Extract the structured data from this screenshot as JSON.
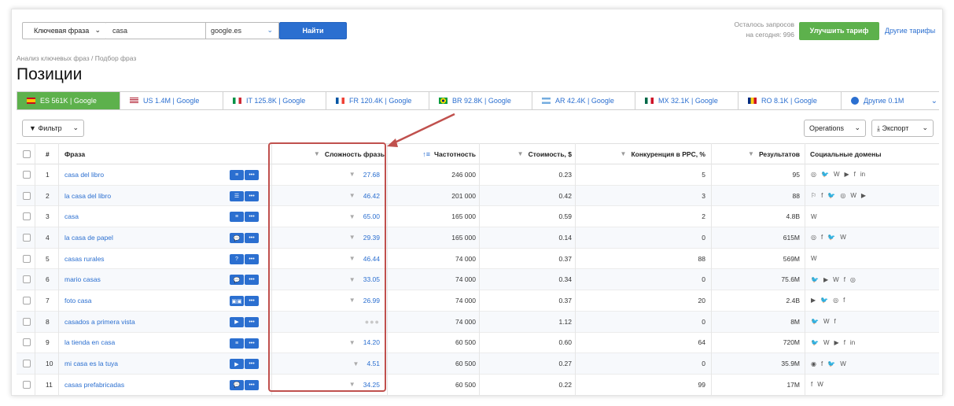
{
  "search": {
    "type_label": "Ключевая фраза",
    "query": "casa",
    "engine": "google.es",
    "find_label": "Найти"
  },
  "quota": {
    "line1": "Осталось запросов",
    "line2": "на сегодня: 996"
  },
  "upgrade_label": "Улучшить тариф",
  "other_plans_label": "Другие тарифы",
  "breadcrumb": "Анализ ключевых фраз / Подбор фраз",
  "page_title": "Позиции",
  "tabs": [
    {
      "label": "ES 561K | Google",
      "flag": "es",
      "active": true
    },
    {
      "label": "US 1.4M | Google",
      "flag": "us"
    },
    {
      "label": "IT 125.8K | Google",
      "flag": "it"
    },
    {
      "label": "FR 120.4K | Google",
      "flag": "fr"
    },
    {
      "label": "BR 92.8K | Google",
      "flag": "br"
    },
    {
      "label": "AR 42.4K | Google",
      "flag": "ar"
    },
    {
      "label": "MX 32.1K | Google",
      "flag": "mx"
    },
    {
      "label": "RO 8.1K | Google",
      "flag": "ro"
    },
    {
      "label": "Другие 0.1M",
      "flag": "globe"
    }
  ],
  "toolbar": {
    "filter_label": "Фильтр",
    "operations_label": "Operations",
    "export_label": "Экспорт"
  },
  "columns": {
    "num": "#",
    "phrase": "Фраза",
    "kd": "Сложность фразы",
    "volume": "Частотность",
    "cpc": "Стоимость, $",
    "competition": "Конкуренция в PPC, %",
    "results": "Результатов",
    "social": "Социальные домены"
  },
  "rows": [
    {
      "n": "1",
      "phrase": "casa del libro",
      "kd": "27.68",
      "volume": "246 000",
      "cpc": "0.23",
      "comp": "5",
      "results": "95",
      "features": [
        "≡",
        "•••"
      ],
      "social": [
        "◎",
        "🐦",
        "W",
        "▶",
        "f",
        "in"
      ]
    },
    {
      "n": "2",
      "phrase": "la casa del libro",
      "kd": "46.42",
      "volume": "201 000",
      "cpc": "0.42",
      "comp": "3",
      "results": "88",
      "features": [
        "☰",
        "•••"
      ],
      "social": [
        "⚐",
        "f",
        "🐦",
        "◎",
        "W",
        "▶"
      ]
    },
    {
      "n": "3",
      "phrase": "casa",
      "kd": "65.00",
      "volume": "165 000",
      "cpc": "0.59",
      "comp": "2",
      "results": "4.8B",
      "features": [
        "≡",
        "•••"
      ],
      "social": [
        "W"
      ]
    },
    {
      "n": "4",
      "phrase": "la casa de papel",
      "kd": "29.39",
      "volume": "165 000",
      "cpc": "0.14",
      "comp": "0",
      "results": "615M",
      "features": [
        "💬",
        "•••"
      ],
      "social": [
        "◎",
        "f",
        "🐦",
        "W"
      ]
    },
    {
      "n": "5",
      "phrase": "casas rurales",
      "kd": "46.44",
      "volume": "74 000",
      "cpc": "0.37",
      "comp": "88",
      "results": "569M",
      "features": [
        "?",
        "•••"
      ],
      "social": [
        "W"
      ]
    },
    {
      "n": "6",
      "phrase": "mario casas",
      "kd": "33.05",
      "volume": "74 000",
      "cpc": "0.34",
      "comp": "0",
      "results": "75.6M",
      "features": [
        "💬",
        "•••"
      ],
      "social": [
        "🐦",
        "▶",
        "W",
        "f",
        "◎"
      ]
    },
    {
      "n": "7",
      "phrase": "foto casa",
      "kd": "26.99",
      "volume": "74 000",
      "cpc": "0.37",
      "comp": "20",
      "results": "2.4B",
      "features": [
        "▣▣",
        "•••"
      ],
      "social": [
        "▶",
        "🐦",
        "◎",
        "f"
      ]
    },
    {
      "n": "8",
      "phrase": "casados a primera vista",
      "kd": "",
      "volume": "74 000",
      "cpc": "1.12",
      "comp": "0",
      "results": "8M",
      "features": [
        "▶",
        "•••"
      ],
      "social": [
        "🐦",
        "W",
        "f"
      ]
    },
    {
      "n": "9",
      "phrase": "la tienda en casa",
      "kd": "14.20",
      "volume": "60 500",
      "cpc": "0.60",
      "comp": "64",
      "results": "720M",
      "features": [
        "≡",
        "•••"
      ],
      "social": [
        "🐦",
        "W",
        "▶",
        "f",
        "in"
      ]
    },
    {
      "n": "10",
      "phrase": "mi casa es la tuya",
      "kd": "4.51",
      "volume": "60 500",
      "cpc": "0.27",
      "comp": "0",
      "results": "35.9M",
      "features": [
        "▶",
        "•••"
      ],
      "social": [
        "◉",
        "f",
        "🐦",
        "W"
      ]
    },
    {
      "n": "11",
      "phrase": "casas prefabricadas",
      "kd": "34.25",
      "volume": "60 500",
      "cpc": "0.22",
      "comp": "99",
      "results": "17M",
      "features": [
        "💬",
        "•••"
      ],
      "social": [
        "f",
        "W"
      ]
    }
  ],
  "colors": {
    "accent": "#2b6fd0",
    "green": "#5db14c",
    "highlight": "#c0504d"
  }
}
